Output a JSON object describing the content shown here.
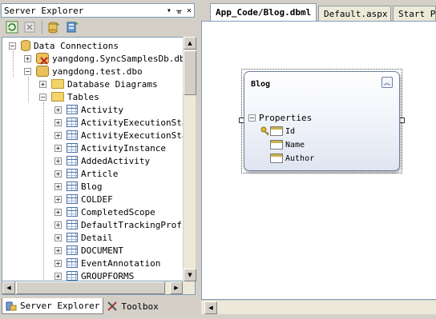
{
  "server_explorer": {
    "title": "Server Explorer",
    "title_buttons": [
      "▾",
      "ᚂ",
      "✕"
    ],
    "toolbar": [
      "refresh-icon",
      "stop-icon",
      "connect-to-database-icon",
      "connect-to-server-icon"
    ],
    "tree": [
      {
        "label": "Data Connections",
        "level": 0,
        "expand": "−",
        "icon": "data-connections-icon"
      },
      {
        "label": "yangdong.SyncSamplesDb.dbo",
        "level": 1,
        "expand": "+",
        "icon": "connection-broken-icon"
      },
      {
        "label": "yangdong.test.dbo",
        "level": 1,
        "expand": "−",
        "icon": "connection-icon"
      },
      {
        "label": "Database Diagrams",
        "level": 2,
        "expand": "+",
        "icon": "folder-icon"
      },
      {
        "label": "Tables",
        "level": 2,
        "expand": "−",
        "icon": "folder-icon"
      },
      {
        "label": "Activity",
        "level": 3,
        "expand": "+",
        "icon": "table-icon"
      },
      {
        "label": "ActivityExecutionSta",
        "level": 3,
        "expand": "+",
        "icon": "table-icon"
      },
      {
        "label": "ActivityExecutionSta",
        "level": 3,
        "expand": "+",
        "icon": "table-icon"
      },
      {
        "label": "ActivityInstance",
        "level": 3,
        "expand": "+",
        "icon": "table-icon"
      },
      {
        "label": "AddedActivity",
        "level": 3,
        "expand": "+",
        "icon": "table-icon"
      },
      {
        "label": "Article",
        "level": 3,
        "expand": "+",
        "icon": "table-icon"
      },
      {
        "label": "Blog",
        "level": 3,
        "expand": "+",
        "icon": "table-icon"
      },
      {
        "label": "COLDEF",
        "level": 3,
        "expand": "+",
        "icon": "table-icon"
      },
      {
        "label": "CompletedScope",
        "level": 3,
        "expand": "+",
        "icon": "table-icon"
      },
      {
        "label": "DefaultTrackingProfi",
        "level": 3,
        "expand": "+",
        "icon": "table-icon"
      },
      {
        "label": "Detail",
        "level": 3,
        "expand": "+",
        "icon": "table-icon"
      },
      {
        "label": "DOCUMENT",
        "level": 3,
        "expand": "+",
        "icon": "table-icon"
      },
      {
        "label": "EventAnnotation",
        "level": 3,
        "expand": "+",
        "icon": "table-icon"
      },
      {
        "label": "GROUPFORMS",
        "level": 3,
        "expand": "+",
        "icon": "table-icon"
      }
    ],
    "bottom_tabs": [
      {
        "label": "Server Explorer",
        "icon": "server-explorer-icon",
        "active": true
      },
      {
        "label": "Toolbox",
        "icon": "toolbox-icon",
        "active": false
      }
    ]
  },
  "document": {
    "tabs": [
      {
        "label": "App_Code/Blog.dbml",
        "active": true
      },
      {
        "label": "Default.aspx",
        "active": false
      },
      {
        "label": "Start Pa",
        "active": false
      }
    ],
    "entity": {
      "name": "Blog",
      "collapse_glyph": "︽",
      "section_label": "Properties",
      "section_expand": "−",
      "fields": [
        {
          "name": "Id",
          "key": true
        },
        {
          "name": "Name",
          "key": false
        },
        {
          "name": "Author",
          "key": false
        }
      ]
    }
  },
  "colors": {
    "chrome": "#d4d0c8",
    "border": "#7f9db9",
    "entity_gradient_end": "#dfe5f1"
  }
}
